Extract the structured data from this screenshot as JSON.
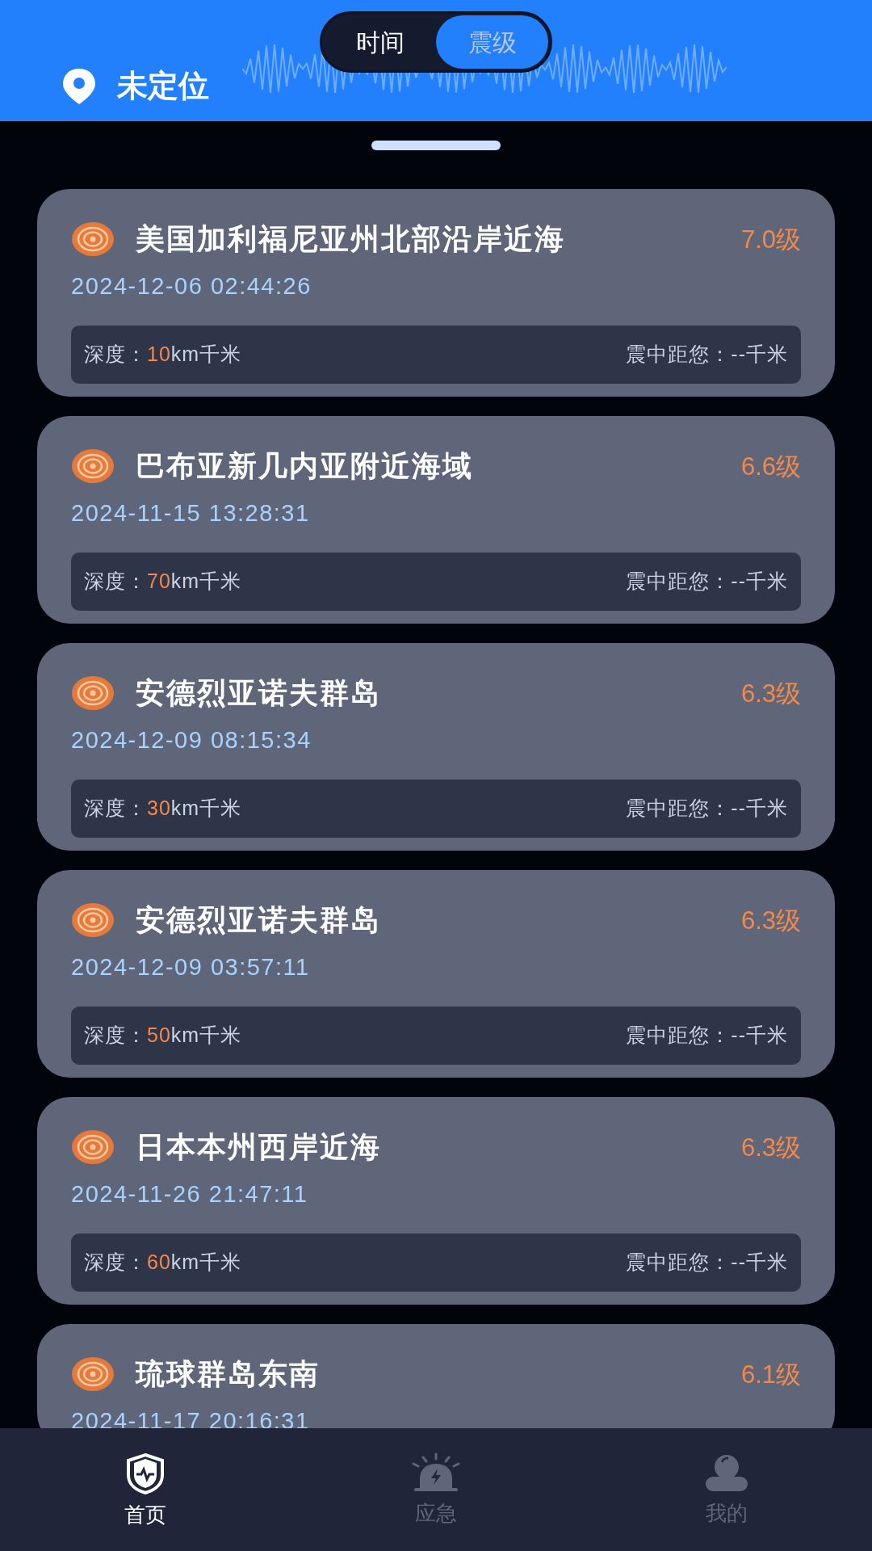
{
  "header": {
    "toggle": [
      {
        "label": "时间",
        "selected": false
      },
      {
        "label": "震级",
        "selected": true
      }
    ],
    "location": "未定位"
  },
  "quakes": [
    {
      "place": "美国加利福尼亚州北部沿岸近海",
      "magnitude": "7.0级",
      "time": "2024-12-06 02:44:26",
      "depth_label": "深度：",
      "depth": "10",
      "depth_unit": "km千米",
      "distance": "震中距您：--千米"
    },
    {
      "place": "巴布亚新几内亚附近海域",
      "magnitude": "6.6级",
      "time": "2024-11-15 13:28:31",
      "depth_label": "深度：",
      "depth": "70",
      "depth_unit": "km千米",
      "distance": "震中距您：--千米"
    },
    {
      "place": "安德烈亚诺夫群岛",
      "magnitude": "6.3级",
      "time": "2024-12-09 08:15:34",
      "depth_label": "深度：",
      "depth": "30",
      "depth_unit": "km千米",
      "distance": "震中距您：--千米"
    },
    {
      "place": "安德烈亚诺夫群岛",
      "magnitude": "6.3级",
      "time": "2024-12-09 03:57:11",
      "depth_label": "深度：",
      "depth": "50",
      "depth_unit": "km千米",
      "distance": "震中距您：--千米"
    },
    {
      "place": "日本本州西岸近海",
      "magnitude": "6.3级",
      "time": "2024-11-26 21:47:11",
      "depth_label": "深度：",
      "depth": "60",
      "depth_unit": "km千米",
      "distance": "震中距您：--千米"
    },
    {
      "place": "琉球群岛东南",
      "magnitude": "6.1级",
      "time": "2024-11-17 20:16:31"
    }
  ],
  "nav": [
    {
      "label": "首页",
      "kind": "home",
      "selected": true
    },
    {
      "label": "应急",
      "kind": "alarm",
      "selected": false
    },
    {
      "label": "我的",
      "kind": "profile",
      "selected": false
    }
  ]
}
